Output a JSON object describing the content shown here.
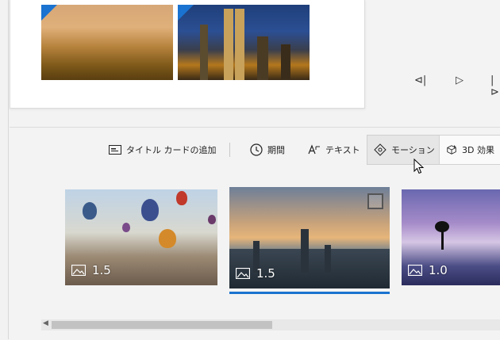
{
  "playback": {
    "prev_glyph": "⊲|",
    "play_glyph": "▷",
    "next_glyph": "|⊳"
  },
  "toolbar": {
    "title_card_label": "タイトル カードの追加",
    "duration_label": "期間",
    "text_label": "テキスト",
    "motion_label": "モーション",
    "effects_3d_label": "3D 効果"
  },
  "clips": [
    {
      "duration": "1.5"
    },
    {
      "duration": "1.5"
    },
    {
      "duration": "1.0"
    }
  ],
  "colors": {
    "accent": "#1a73d0"
  }
}
